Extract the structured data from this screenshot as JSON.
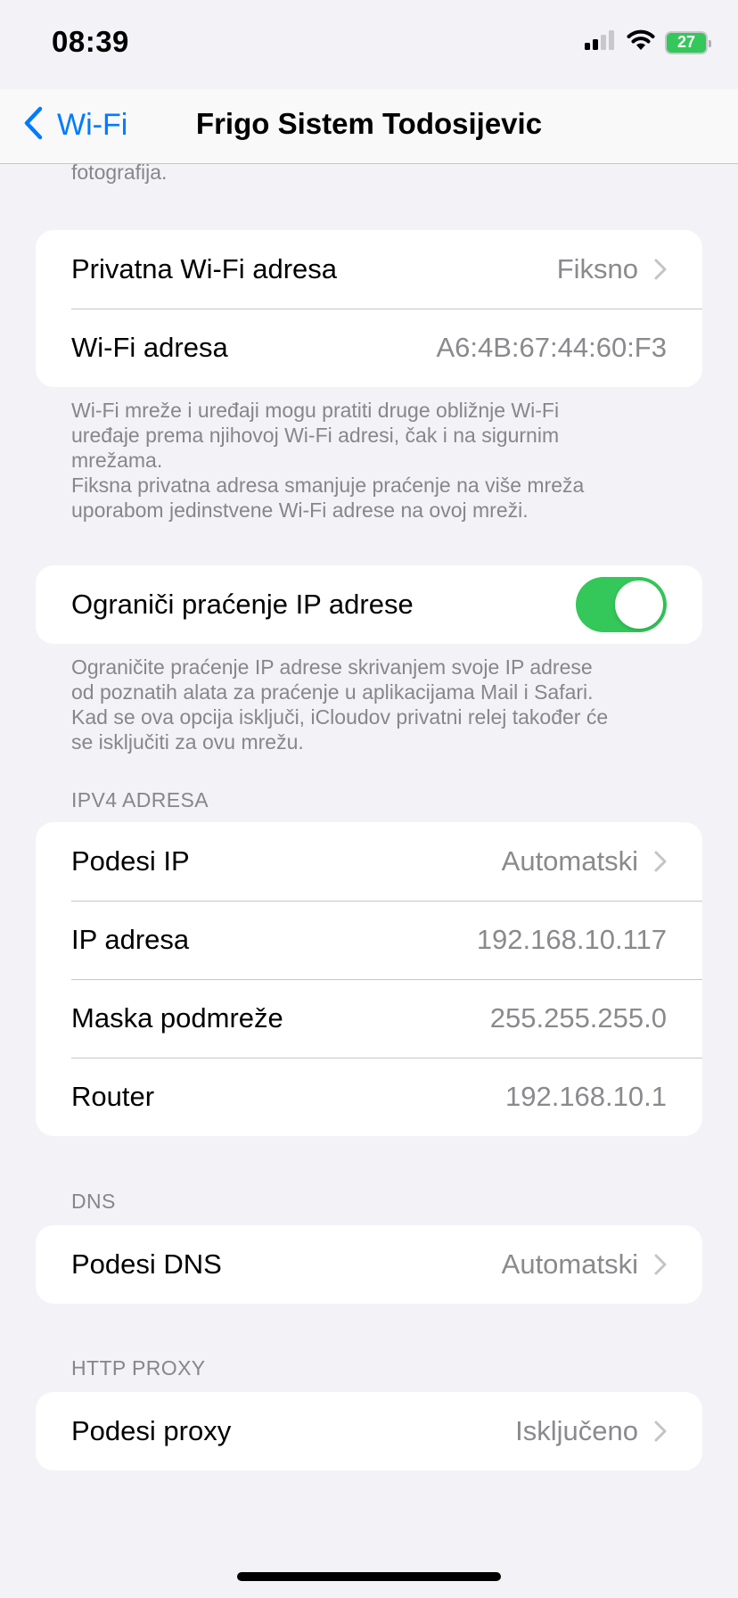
{
  "status_bar": {
    "time": "08:39",
    "battery": "27",
    "icons": [
      "signal-icon",
      "wifi-icon",
      "battery-icon"
    ]
  },
  "nav": {
    "back_label": "Wi-Fi",
    "title": "Frigo Sistem Todosijevic"
  },
  "top_cut_text": "fotografija.",
  "private_address": {
    "rows": [
      {
        "label": "Privatna Wi-Fi adresa",
        "value": "Fiksno",
        "chevron": true
      },
      {
        "label": "Wi-Fi adresa",
        "value": "A6:4B:67:44:60:F3",
        "chevron": false
      }
    ],
    "footer_lines": [
      "Wi-Fi mreže i uređaji mogu pratiti druge obližnje Wi-Fi",
      "uređaje prema njihovoj Wi-Fi adresi, čak i na sigurnim",
      "mrežama.",
      "Fiksna privatna adresa smanjuje praćenje na više mreža",
      "uporabom jedinstvene Wi-Fi adrese na ovoj mreži."
    ]
  },
  "ip_tracking": {
    "label": "Ograniči praćenje IP adrese",
    "enabled": true,
    "footer_lines": [
      "Ograničite praćenje IP adrese skrivanjem svoje IP adrese",
      "od poznatih alata za praćenje u aplikacijama Mail i Safari.",
      "Kad se ova opcija isključi, iCloudov privatni relej također će",
      "se isključiti za ovu mrežu."
    ]
  },
  "ipv4": {
    "header": "IPV4 ADRESA",
    "rows": [
      {
        "label": "Podesi IP",
        "value": "Automatski",
        "chevron": true
      },
      {
        "label": "IP adresa",
        "value": "192.168.10.117",
        "chevron": false
      },
      {
        "label": "Maska podmreže",
        "value": "255.255.255.0",
        "chevron": false
      },
      {
        "label": "Router",
        "value": "192.168.10.1",
        "chevron": false
      }
    ]
  },
  "dns": {
    "header": "DNS",
    "rows": [
      {
        "label": "Podesi DNS",
        "value": "Automatski",
        "chevron": true
      }
    ]
  },
  "proxy": {
    "header": "HTTP PROXY",
    "rows": [
      {
        "label": "Podesi proxy",
        "value": "Isključeno",
        "chevron": true
      }
    ]
  },
  "colors": {
    "accent": "#007aff",
    "toggle_on": "#34c759",
    "background": "#f2f2f7",
    "secondary_text": "#8a8a8e"
  }
}
